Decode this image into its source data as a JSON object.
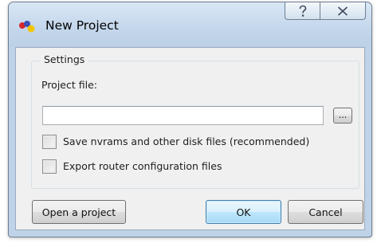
{
  "window": {
    "title": "New Project",
    "help_glyph": "?",
    "close_glyph": "✕"
  },
  "settings": {
    "group_label": "Settings",
    "project_file_label": "Project file:",
    "project_file_value": "",
    "browse_label": "...",
    "save_nvrams_label": "Save nvrams and other disk files (recommended)",
    "save_nvrams_checked": false,
    "export_router_label": "Export router configuration files",
    "export_router_checked": false
  },
  "buttons": {
    "open_project": "Open a project",
    "ok": "OK",
    "cancel": "Cancel"
  },
  "icons": {
    "app": "app-logo-icon",
    "help": "help-icon",
    "close": "close-icon"
  }
}
